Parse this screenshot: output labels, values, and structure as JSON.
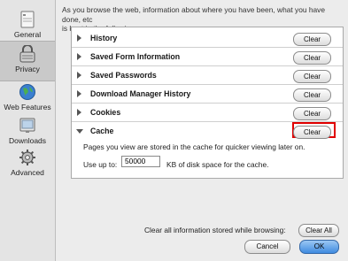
{
  "sidebar": {
    "items": [
      {
        "label": "General",
        "icon": "general-icon",
        "selected": false
      },
      {
        "label": "Privacy",
        "icon": "privacy-icon",
        "selected": true
      },
      {
        "label": "Web Features",
        "icon": "web-features-icon",
        "selected": false
      },
      {
        "label": "Downloads",
        "icon": "downloads-icon",
        "selected": false
      },
      {
        "label": "Advanced",
        "icon": "advanced-icon",
        "selected": false
      }
    ]
  },
  "intro": {
    "line1": "As you browse the web, information about where you have been, what you have done, etc",
    "line2": "is kept in the following areas."
  },
  "sections": [
    {
      "label": "History",
      "button": "Clear",
      "expanded": false
    },
    {
      "label": "Saved Form Information",
      "button": "Clear",
      "expanded": false
    },
    {
      "label": "Saved Passwords",
      "button": "Clear",
      "expanded": false
    },
    {
      "label": "Download Manager History",
      "button": "Clear",
      "expanded": false
    },
    {
      "label": "Cookies",
      "button": "Clear",
      "expanded": false
    },
    {
      "label": "Cache",
      "button": "Clear",
      "expanded": true
    }
  ],
  "cache": {
    "description": "Pages you view are stored in the cache for quicker viewing later on.",
    "use_up_to_label": "Use up to:",
    "size_value": "50000",
    "unit_label": "KB of disk space for the cache."
  },
  "footer": {
    "clear_all_label": "Clear all information stored while browsing:",
    "clear_all_button": "Clear All",
    "cancel_button": "Cancel",
    "ok_button": "OK"
  },
  "colors": {
    "highlight": "#e00000",
    "ok_button": "#3f8be0"
  }
}
